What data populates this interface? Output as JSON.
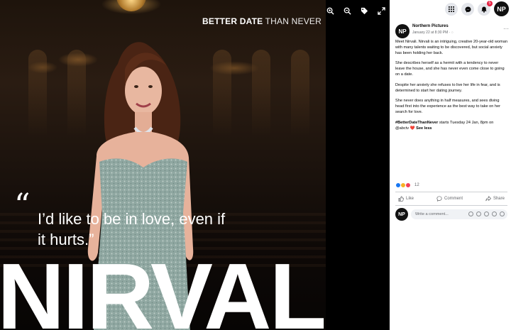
{
  "photo": {
    "brand_bold": "BETTER DATE",
    "brand_rest": "THAN NEVER",
    "quote_mark": "“",
    "quote": "I’d like to be in love, even if it hurts.”",
    "name": "NIRVALI"
  },
  "viewer_tools": [
    "zoom-in-icon",
    "zoom-out-icon",
    "tag-icon",
    "fullscreen-icon"
  ],
  "topbar": {
    "notification_count": "5",
    "avatar_initials": "NP"
  },
  "post": {
    "avatar_initials": "NP",
    "page_name": "Northern Pictures",
    "time": "January 22 at 8:30 PM · ◌",
    "more": "···",
    "paragraphs": [
      "Meet Nirvali. Nirvali is an intriguing, creative 20-year-old woman with many talents waiting to be discovered, but social anxiety has been holding her back.",
      "She describes herself as a hermit with a tendency to never leave the house, and she has never even come close to going on a date.",
      "Despite her anxiety she refuses to live her life in fear, and is determined to start her dating journey.",
      "She never does anything in half measures, and sees diving head first into the experience as the best way to take on her search for love."
    ],
    "hashtag": "#BetterDateThanNever",
    "last_line": " starts Tuesday 24 Jan, 8pm on @abctv ",
    "heart": "❤️",
    "see_less": "See less",
    "reaction_count": "12",
    "actions": {
      "like": "Like",
      "comment": "Comment",
      "share": "Share"
    },
    "comment_avatar": "NP",
    "comment_placeholder": "Write a comment..."
  },
  "colors": {
    "accent_blue": "#1877f2",
    "love_red": "#f33e58",
    "haha_yellow": "#f7b125",
    "notification_red": "#e41e3f"
  }
}
